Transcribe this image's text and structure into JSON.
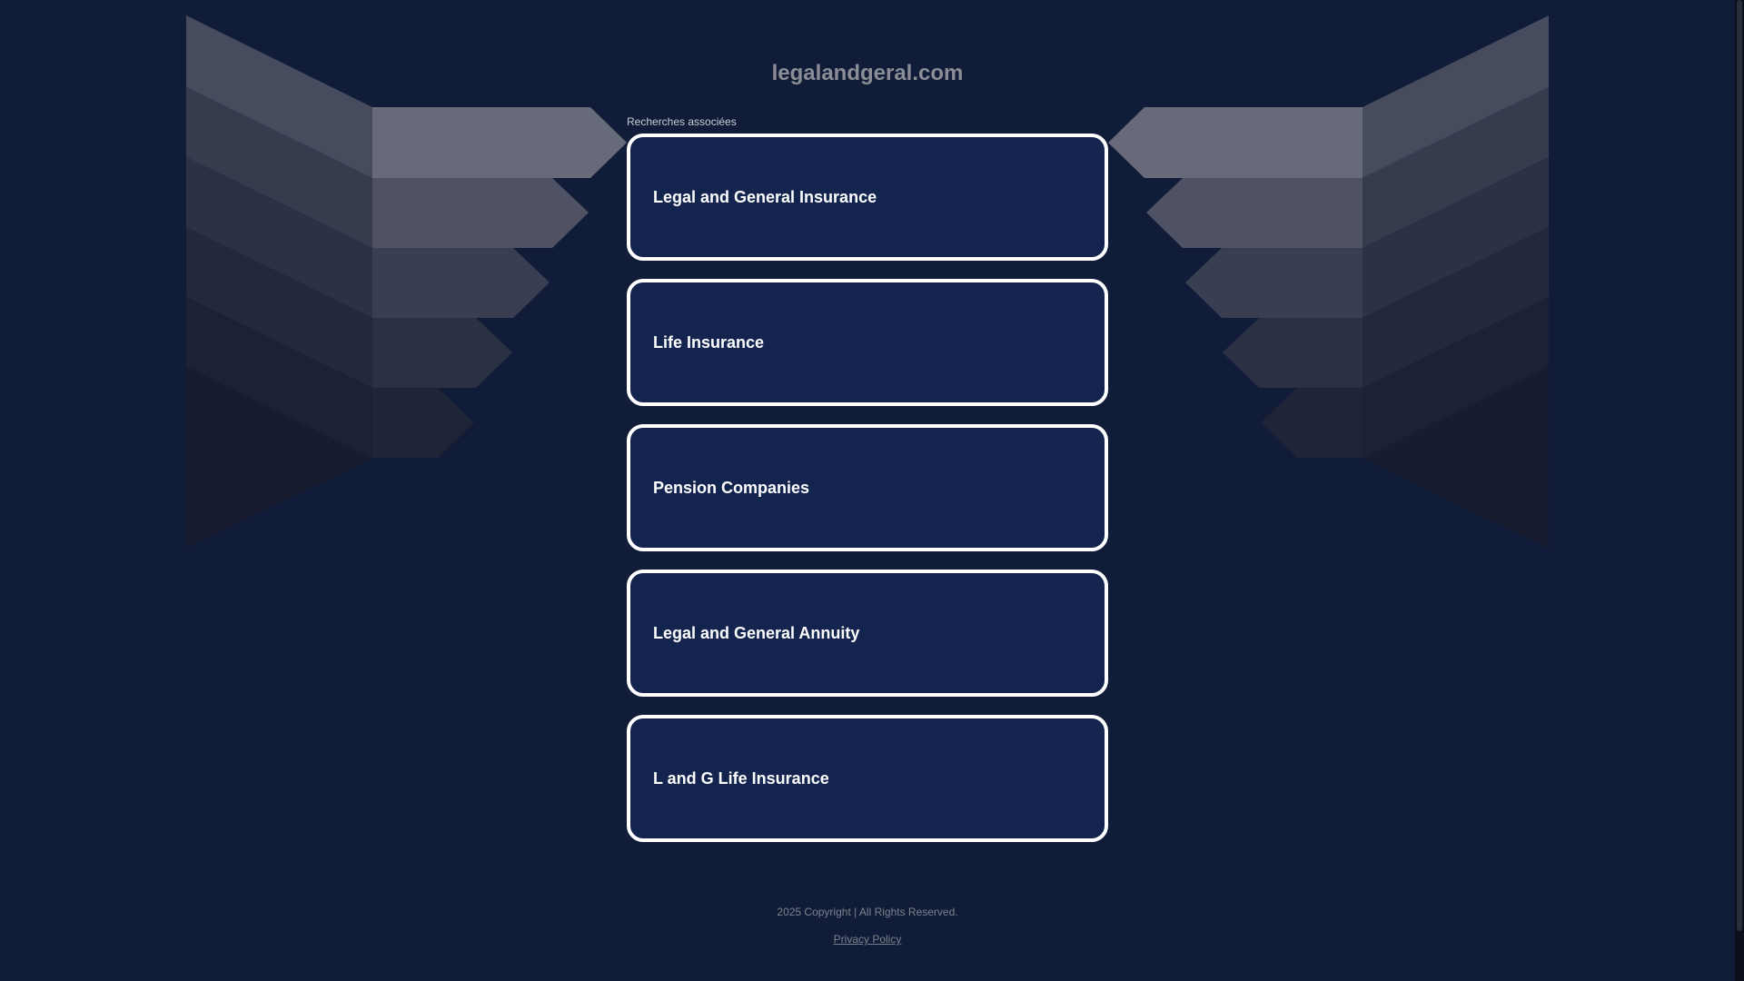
{
  "site": {
    "domain": "legalandgeral.com",
    "related_label": "Recherches associées"
  },
  "links": [
    {
      "label": "Legal and General Insurance"
    },
    {
      "label": "Life Insurance"
    },
    {
      "label": "Pension Companies"
    },
    {
      "label": "Legal and General Annuity"
    },
    {
      "label": "L and G Life Insurance"
    }
  ],
  "footer": {
    "copyright": "2025 Copyright | All Rights Reserved.",
    "privacy_label": "Privacy Policy"
  },
  "colors": {
    "background": "#111d38",
    "card": "#13244e",
    "card_border": "#ffffff",
    "title": "#8a8d96"
  }
}
